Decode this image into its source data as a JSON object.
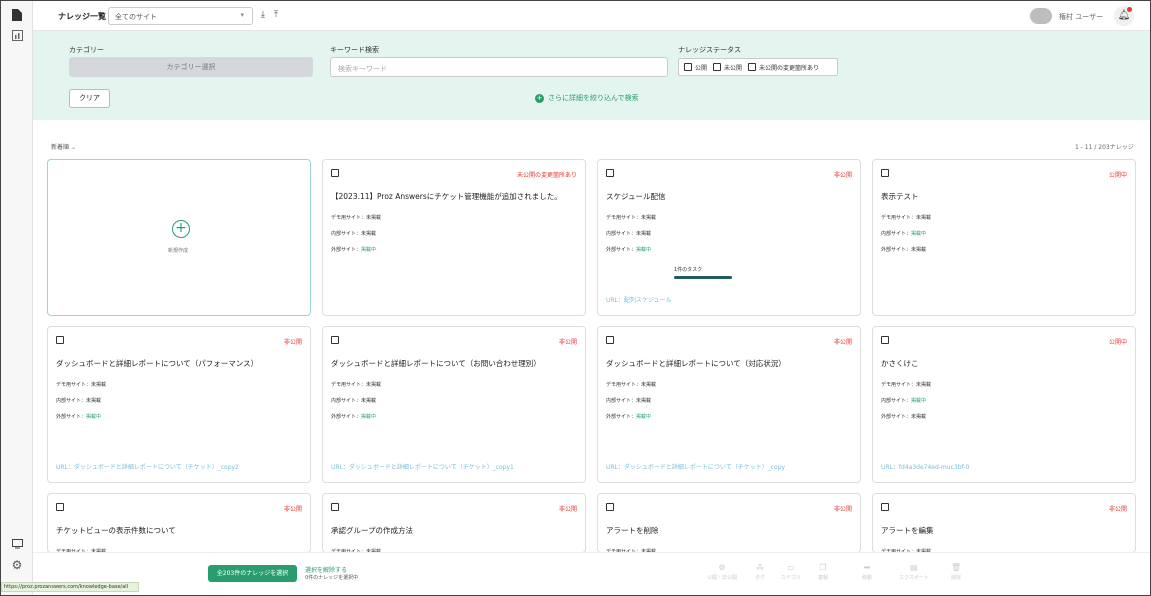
{
  "header": {
    "title": "ナレッジ一覧",
    "site_select": "全てのサイト",
    "user_avatar": "",
    "user_name": "権村 ユーザー"
  },
  "filters": {
    "category_label": "カテゴリー",
    "category_button": "カテゴリー選択",
    "keyword_label": "キーワード検索",
    "keyword_placeholder": "検索キーワード",
    "status_label": "ナレッジステータス",
    "status_options": [
      "公開",
      "未公開",
      "未公開の変更箇所あり"
    ],
    "clear_button": "クリア",
    "more_link": "さらに詳細を絞り込んで検索"
  },
  "list": {
    "sort_label": "新着順",
    "pager": "1 - 11 / 203ナレッジ"
  },
  "new_card": {
    "label": "新規作成"
  },
  "cards": [
    {
      "status": "未公開の変更箇所あり",
      "title": "【2023.11】Proz Answersにチケット管理機能が追加されました。",
      "lines": [
        {
          "k": "デモ用サイト：",
          "v": "未掲載",
          "ok": false
        },
        {
          "k": "内部サイト：",
          "v": "未掲載",
          "ok": false
        },
        {
          "k": "外部サイト：",
          "v": "掲載中",
          "ok": true
        }
      ],
      "url": ""
    },
    {
      "status": "非公開",
      "title": "スケジュール配信",
      "lines": [
        {
          "k": "デモ用サイト：",
          "v": "未掲載",
          "ok": false
        },
        {
          "k": "内部サイト：",
          "v": "未掲載",
          "ok": false
        },
        {
          "k": "外部サイト：",
          "v": "掲載中",
          "ok": true
        }
      ],
      "task": {
        "label": "1件のタスク",
        "progress": 1.0
      },
      "url": "URL：配列スケジュール"
    },
    {
      "status": "公開中",
      "title": "表示テスト",
      "lines": [
        {
          "k": "デモ用サイト：",
          "v": "未掲載",
          "ok": false
        },
        {
          "k": "内部サイト：",
          "v": "掲載中",
          "ok": true
        },
        {
          "k": "外部サイト：",
          "v": "未掲載",
          "ok": false
        }
      ],
      "url": ""
    },
    {
      "status": "非公開",
      "title": "ダッシュボードと詳細レポートについて（パフォーマンス）",
      "lines": [
        {
          "k": "デモ用サイト：",
          "v": "未掲載",
          "ok": false
        },
        {
          "k": "内部サイト：",
          "v": "未掲載",
          "ok": false
        },
        {
          "k": "外部サイト：",
          "v": "掲載中",
          "ok": true
        }
      ],
      "url": "URL：ダッシュボードと詳細レポートについて（チケット）_copy2"
    },
    {
      "status": "非公開",
      "title": "ダッシュボードと詳細レポートについて（お問い合わせ理別）",
      "lines": [
        {
          "k": "デモ用サイト：",
          "v": "未掲載",
          "ok": false
        },
        {
          "k": "内部サイト：",
          "v": "未掲載",
          "ok": false
        },
        {
          "k": "外部サイト：",
          "v": "掲載中",
          "ok": true
        }
      ],
      "url": "URL：ダッシュボードと詳細レポートについて（チケット）_copy1"
    },
    {
      "status": "非公開",
      "title": "ダッシュボードと詳細レポートについて（対応状況）",
      "lines": [
        {
          "k": "デモ用サイト：",
          "v": "未掲載",
          "ok": false
        },
        {
          "k": "内部サイト：",
          "v": "未掲載",
          "ok": false
        },
        {
          "k": "外部サイト：",
          "v": "掲載中",
          "ok": true
        }
      ],
      "url": "URL：ダッシュボードと詳細レポートについて（チケット）_copy"
    },
    {
      "status": "公開中",
      "title": "かさくけこ",
      "lines": [
        {
          "k": "デモ用サイト：",
          "v": "未掲載",
          "ok": false
        },
        {
          "k": "内部サイト：",
          "v": "掲載中",
          "ok": true
        },
        {
          "k": "外部サイト：",
          "v": "未掲載",
          "ok": false
        }
      ],
      "url": "URL：fd4a3de74ed-muc3bf-0"
    },
    {
      "status": "非公開",
      "title": "チケットビューの表示件数について",
      "lines": [
        {
          "k": "デモ用サイト：",
          "v": "未掲載",
          "ok": false
        }
      ],
      "url": ""
    },
    {
      "status": "非公開",
      "title": "承認グループの作成方法",
      "lines": [
        {
          "k": "デモ用サイト：",
          "v": "未掲載",
          "ok": false
        }
      ],
      "url": ""
    },
    {
      "status": "非公開",
      "title": "アラートを削除",
      "lines": [
        {
          "k": "デモ用サイト：",
          "v": "未掲載",
          "ok": false
        }
      ],
      "url": ""
    },
    {
      "status": "非公開",
      "title": "アラートを編集",
      "lines": [
        {
          "k": "デモ用サイト：",
          "v": "未掲載",
          "ok": false
        }
      ],
      "url": ""
    }
  ],
  "bottom": {
    "select_all": "全203件のナレッジを選択",
    "unselect": "選択を解除する",
    "selected_count": "0件のナレッジを選択中",
    "actions": [
      "公開・非公開",
      "タグ",
      "カテゴリ",
      "複製",
      "移動",
      "エクスポート",
      "削除"
    ]
  },
  "status_url": "https://proz.prozanswers.com/knowledge-base/all"
}
